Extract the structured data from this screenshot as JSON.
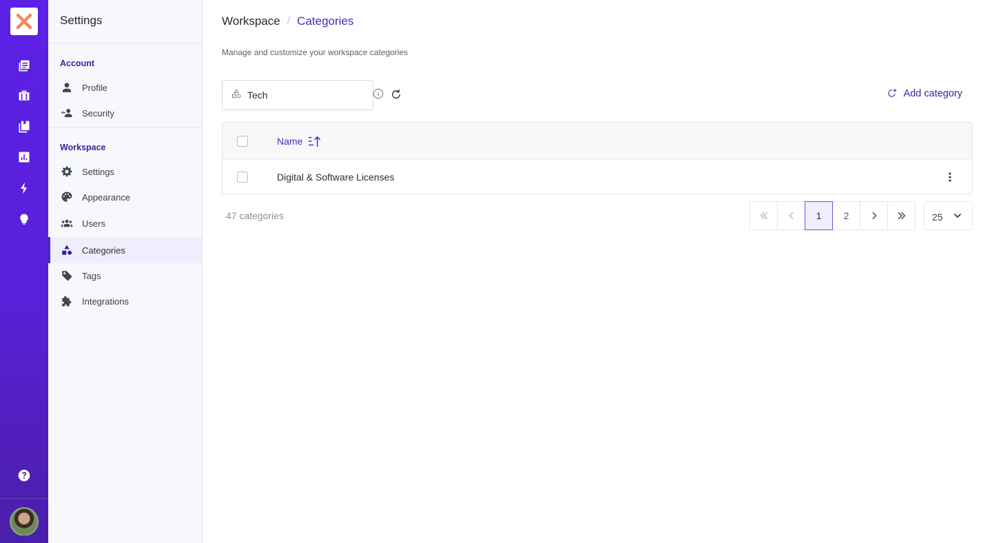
{
  "rail": {
    "items": [
      "notes-icon",
      "briefcase-icon",
      "documents-icon",
      "chart-icon",
      "bolt-icon",
      "bulb-icon"
    ],
    "help_icon": "help-icon"
  },
  "sidebar": {
    "title": "Settings",
    "sections": [
      {
        "label": "Account",
        "items": [
          {
            "label": "Profile",
            "icon": "person-icon"
          },
          {
            "label": "Security",
            "icon": "user-key-icon"
          }
        ]
      },
      {
        "label": "Workspace",
        "items": [
          {
            "label": "Settings",
            "icon": "gear-icon"
          },
          {
            "label": "Appearance",
            "icon": "palette-icon"
          },
          {
            "label": "Users",
            "icon": "users-icon"
          },
          {
            "label": "Categories",
            "icon": "shapes-icon",
            "active": true
          },
          {
            "label": "Tags",
            "icon": "tag-icon"
          },
          {
            "label": "Integrations",
            "icon": "puzzle-icon"
          }
        ]
      }
    ]
  },
  "breadcrumb": {
    "root": "Workspace",
    "separator": "/",
    "current": "Categories"
  },
  "subtitle": "Manage and customize your workspace categories",
  "search": {
    "value": "Tech"
  },
  "actions": {
    "add_category": "Add category"
  },
  "table": {
    "columns": [
      {
        "label": "Name",
        "sort": "ascending"
      }
    ],
    "rows": [
      {
        "name": "Digital & Software Licenses"
      }
    ]
  },
  "footer": {
    "count": "47 categories",
    "pages": [
      "1",
      "2"
    ],
    "current_page": "1",
    "page_size": "25"
  },
  "colors": {
    "accent": "#4b2bb0",
    "rail": "#5b21e6",
    "logo_mark": "#f08a5d"
  }
}
